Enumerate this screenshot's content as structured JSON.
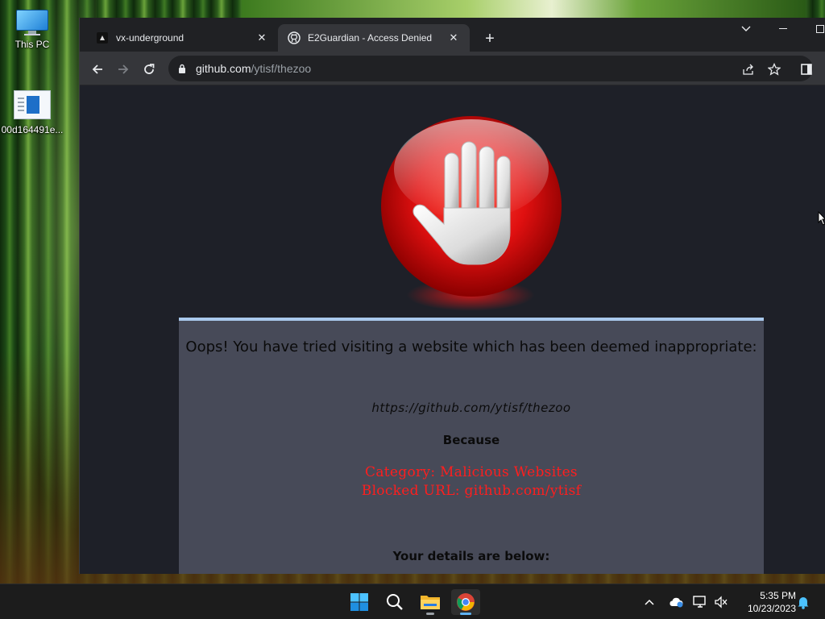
{
  "desktop": {
    "icons": [
      {
        "label": "This PC"
      },
      {
        "label": "00d164491e..."
      }
    ]
  },
  "browser": {
    "tabs": [
      {
        "title": "vx-underground",
        "active": false
      },
      {
        "title": "E2Guardian - Access Denied",
        "active": true
      }
    ],
    "address": {
      "host": "github.com",
      "path": "/ytisf/thezoo"
    }
  },
  "page": {
    "message": "Oops! You have tried visiting a website which has been deemed inappropriate:",
    "blocked_url": "https://github.com/ytisf/thezoo",
    "because": "Because",
    "category_line": "Category: Malicious Websites",
    "blocked_line": "Blocked URL: github.com/ytisf",
    "details": "Your details are below:"
  },
  "taskbar": {
    "time": "5:35 PM",
    "date": "10/23/2023"
  },
  "colors": {
    "page_bg": "#1e2028",
    "panel_bg": "#474a58",
    "panel_border": "#a9c9ec",
    "alert_red": "#ff1e1e"
  }
}
